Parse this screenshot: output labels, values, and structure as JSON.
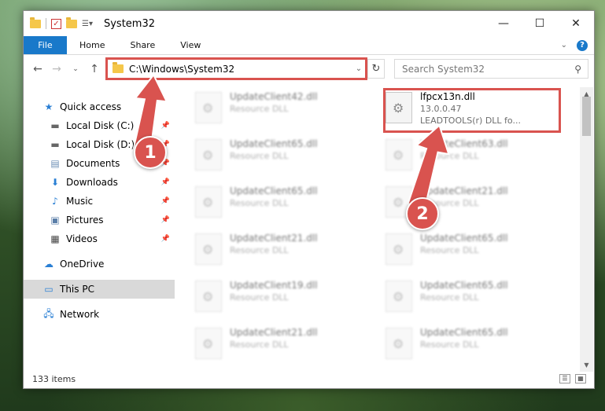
{
  "window": {
    "title": "System32",
    "controls": {
      "minimize": "—",
      "maximize": "☐",
      "close": "✕"
    }
  },
  "ribbon": {
    "file_tab": "File",
    "tabs": [
      "Home",
      "Share",
      "View"
    ]
  },
  "address_bar": {
    "path": "C:\\Windows\\System32"
  },
  "search": {
    "placeholder": "Search System32"
  },
  "sidebar": {
    "items": [
      {
        "label": "Quick access",
        "icon": "star-icon"
      },
      {
        "label": "Local Disk (C:)",
        "icon": "drive-icon"
      },
      {
        "label": "Local Disk (D:)",
        "icon": "drive-icon"
      },
      {
        "label": "Documents",
        "icon": "documents-icon"
      },
      {
        "label": "Downloads",
        "icon": "download-icon"
      },
      {
        "label": "Music",
        "icon": "music-icon"
      },
      {
        "label": "Pictures",
        "icon": "pictures-icon"
      },
      {
        "label": "Videos",
        "icon": "videos-icon"
      },
      {
        "label": "OneDrive",
        "icon": "cloud-icon"
      },
      {
        "label": "This PC",
        "icon": "computer-icon"
      },
      {
        "label": "Network",
        "icon": "network-icon"
      }
    ]
  },
  "highlighted_file": {
    "name": "lfpcx13n.dll",
    "version": "13.0.0.47",
    "description": "LEADTOOLS(r) DLL fo..."
  },
  "blurred_files": [
    {
      "name": "UpdateClient42.dll",
      "desc": "Resource DLL"
    },
    {
      "name": "UpdateClient65.dll",
      "desc": "Resource DLL"
    },
    {
      "name": "UpdateClient63.dll",
      "desc": "Resource DLL"
    },
    {
      "name": "UpdateClient65.dll",
      "desc": "Resource DLL"
    },
    {
      "name": "UpdateClient21.dll",
      "desc": "Resource DLL"
    },
    {
      "name": "UpdateClient21.dll",
      "desc": "Resource DLL"
    },
    {
      "name": "UpdateClient65.dll",
      "desc": "Resource DLL"
    },
    {
      "name": "UpdateClient19.dll",
      "desc": "Resource DLL"
    },
    {
      "name": "UpdateClient65.dll",
      "desc": "Resource DLL"
    },
    {
      "name": "UpdateClient21.dll",
      "desc": "Resource DLL"
    },
    {
      "name": "UpdateClient65.dll",
      "desc": "Resource DLL"
    }
  ],
  "status": {
    "item_count": "133 items"
  },
  "callouts": {
    "one": "1",
    "two": "2"
  },
  "colors": {
    "accent": "#1979ca",
    "highlight": "#d9534f"
  }
}
